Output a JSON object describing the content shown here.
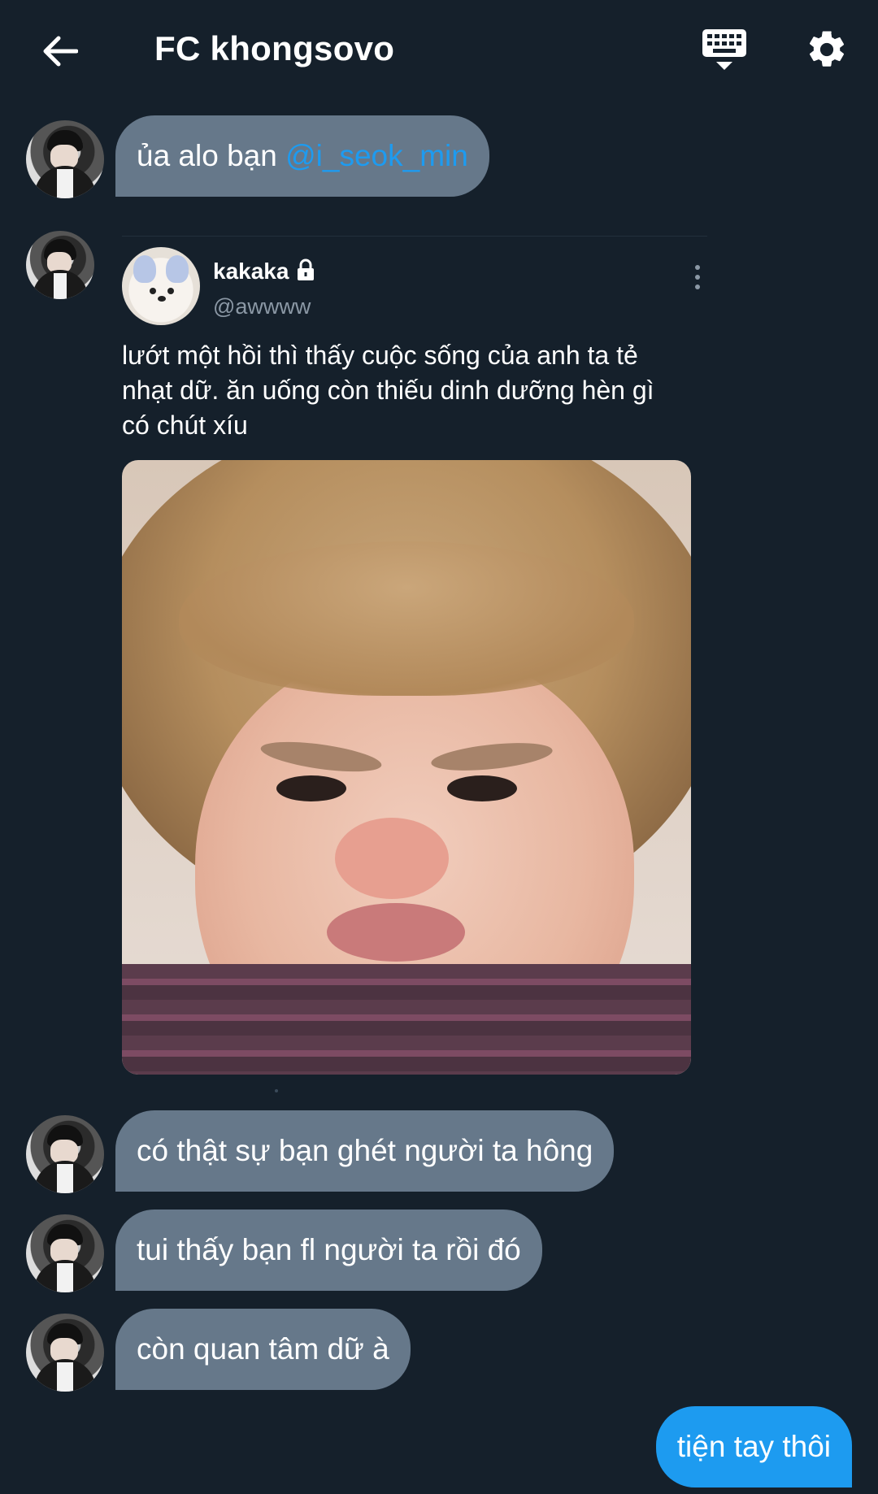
{
  "header": {
    "title": "FC khongsovo",
    "back_icon": "arrow-left-icon",
    "keyboard_icon": "keyboard-icon",
    "settings_icon": "gear-icon"
  },
  "messages": {
    "m1": {
      "text_before": "ủa alo bạn ",
      "mention": "@i_seok_min"
    },
    "m3": "có thật sự bạn ghét người ta hông",
    "m4": "tui thấy bạn fl người ta rồi đó",
    "m5": "còn quan tâm dữ à",
    "m6": "tiện tay thôi"
  },
  "shared_tweet": {
    "name": "kakaka",
    "handle": "@awwww",
    "text": "lướt một hồi thì thấy cuộc sống của anh ta tẻ\nnhạt dữ. ăn uống còn thiếu dinh dưỡng hèn gì\ncó chút xíu",
    "has_photo": true,
    "protected": true
  },
  "colors": {
    "background": "#15202b",
    "incoming_bubble": "#66788a",
    "outgoing_bubble": "#1d9bf0",
    "mention": "#1d9bf0",
    "secondary_text": "#8b98a5"
  }
}
